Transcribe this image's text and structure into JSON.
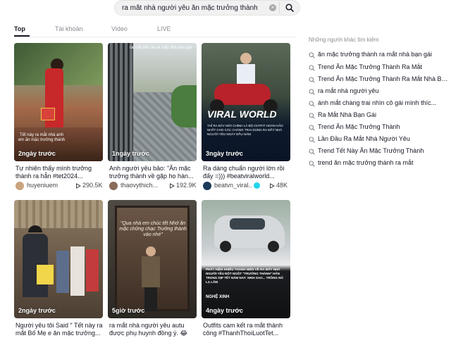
{
  "search": {
    "query": "ra mắt nhà người yêu ăn mặc trưởng thành",
    "clear_symbol": "×"
  },
  "tabs": [
    {
      "label": "Top",
      "active": true
    },
    {
      "label": "Tài khoản",
      "active": false
    },
    {
      "label": "Video",
      "active": false
    },
    {
      "label": "LIVE",
      "active": false
    }
  ],
  "videos": [
    {
      "date": "2ngày trước",
      "overlay": "Tết này ra mắt nhà anh em ăn mặc trưởng thành",
      "caption": "Tự nhiên thấy mình trưởng thành ra hẳn ",
      "hashtag": "#tet2024...",
      "author": "huyeniuem",
      "plays": "290.5K",
      "verified": false
    },
    {
      "date": "1ngày trước",
      "overlay": "ra mắt tiền về ra mắt nhà bạn gái",
      "caption": "Anh người yêu bảo: \"Ăn mặc trưởng thành về gặp họ hàn...",
      "hashtag": "",
      "author": "thaovythich...",
      "plays": "192.9K",
      "verified": false
    },
    {
      "date": "3ngày trước",
      "overlay": "VIRAL WORLD",
      "overlay_sub": "THỈ RA ĐÂY MỚI CHÍNH LÀ BỘ OUTFIT HOÀN HẢO NHẤT CHO CÁC CHÀNG TRAI DÙNG RA MẮT NHÀ NGƯỜI YÊU NGÀY ĐẦU NĂM",
      "caption": "Ra dáng chuẩn người lớn rồi đấy =))) ",
      "hashtag": "#beatviralworld...",
      "author": "beatvn_viral...",
      "plays": "48K",
      "verified": true
    },
    {
      "date": "2ngày trước",
      "overlay": "",
      "caption": "Người yêu tôi Said \" Tết này ra mắt Bố Mẹ e ăn mặc trưởng...",
      "hashtag": "",
      "author": "",
      "plays": "",
      "verified": false
    },
    {
      "date": "5giờ trước",
      "overlay": "\"Qua nhà em chúc tết Nhớ ăn mặc chững chạc Trưởng thành vào nhé\"",
      "caption": "ra mắt nhà người yêu autu được phụ huynh đồng ý. 😂",
      "hashtag": "",
      "author": "",
      "plays": "",
      "verified": false
    },
    {
      "date": "4ngày trước",
      "overlay": "PHÁT HIỆN NHIỀU THANH NIÊN VỀ RA MẮT NHÀ NGƯỜI YÊU ĐỘT NGỘT \"TRƯỞNG THÀNH\" HẲN TRONG DỊP TẾT NĂM NAY: SINH SAO... TRÔNG NÓ LẠ LẮM",
      "overlay_brand": "NGHỆ XINH",
      "caption": "Outfits cam kết ra mắt thành công ",
      "hashtag": "#ThanhThoiLuotTet...",
      "author": "",
      "plays": "",
      "verified": false
    }
  ],
  "side": {
    "title": "Những người khác tìm kiếm",
    "suggestions": [
      "ăn mặc trưởng thành ra mắt nhà bạn gái",
      "Trend Ăn Mặc Trưởng Thành Ra Mắt",
      "Trend Ăn Mặc Trưởng Thành Ra Mắt Nhà Bạn...",
      "ra mắt nhà người yêu",
      "ánh mắt chàng trai nhìn cô gái mình thíc...",
      "Ra Mắt Nhà Bạn Gái",
      "Trend Ăn Mặc Trưởng Thành",
      "Lần Đầu Ra Mắt Nhà Người Yêu",
      "Trend Tết Này Ăn Mặc Trưởng Thành",
      "trend ăn mặc trưởng thành ra mắt"
    ]
  },
  "colors": {
    "text": "#161823",
    "muted": "#8a8b91",
    "search_bg": "#f1f1f2",
    "verified": "#20d5ec"
  }
}
